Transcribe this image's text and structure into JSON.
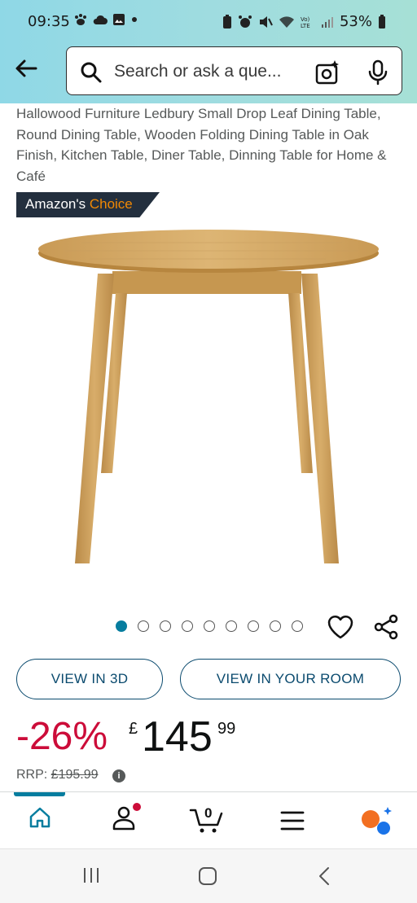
{
  "status_bar": {
    "time": "09:35",
    "battery": "53%",
    "icons": [
      "paw-icon",
      "cloud-icon",
      "image-icon",
      "dot-icon",
      "battery-saver-icon",
      "alarm-icon",
      "mute-icon",
      "wifi-icon",
      "volte-icon",
      "signal-icon",
      "battery-icon"
    ]
  },
  "header": {
    "back_icon": "back-arrow-icon",
    "search_placeholder": "Search or ask a que...",
    "camera_icon": "camera-search-icon",
    "mic_icon": "mic-icon"
  },
  "product": {
    "title": "Hallowood Furniture Ledbury Small Drop Leaf Dining Table, Round Dining Table, Wooden Folding Dining Table in Oak Finish, Kitchen Table, Diner Table, Dinning Table for Home & Café",
    "badge_prefix": "Amazon's ",
    "badge_highlight": "Choice",
    "image_count": 9,
    "active_image": 1,
    "view_3d_label": "VIEW IN 3D",
    "view_room_label": "VIEW IN YOUR ROOM",
    "discount": "-26%",
    "currency": "£",
    "price_whole": "145",
    "price_fraction": "99",
    "rrp_label": "RRP: ",
    "rrp_value": "£195.99"
  },
  "bottom_nav": {
    "items": [
      "home-icon",
      "account-icon",
      "cart-icon",
      "menu-icon",
      "rufus-ai-icon"
    ],
    "cart_count": "0",
    "accent": "#067d9f"
  },
  "system_nav": [
    "recents-icon",
    "home-button-icon",
    "back-icon"
  ],
  "colors": {
    "badge_bg": "#232f3e",
    "badge_highlight": "#f08804",
    "discount": "#cc0c39",
    "button_border": "#0a4a6e"
  }
}
